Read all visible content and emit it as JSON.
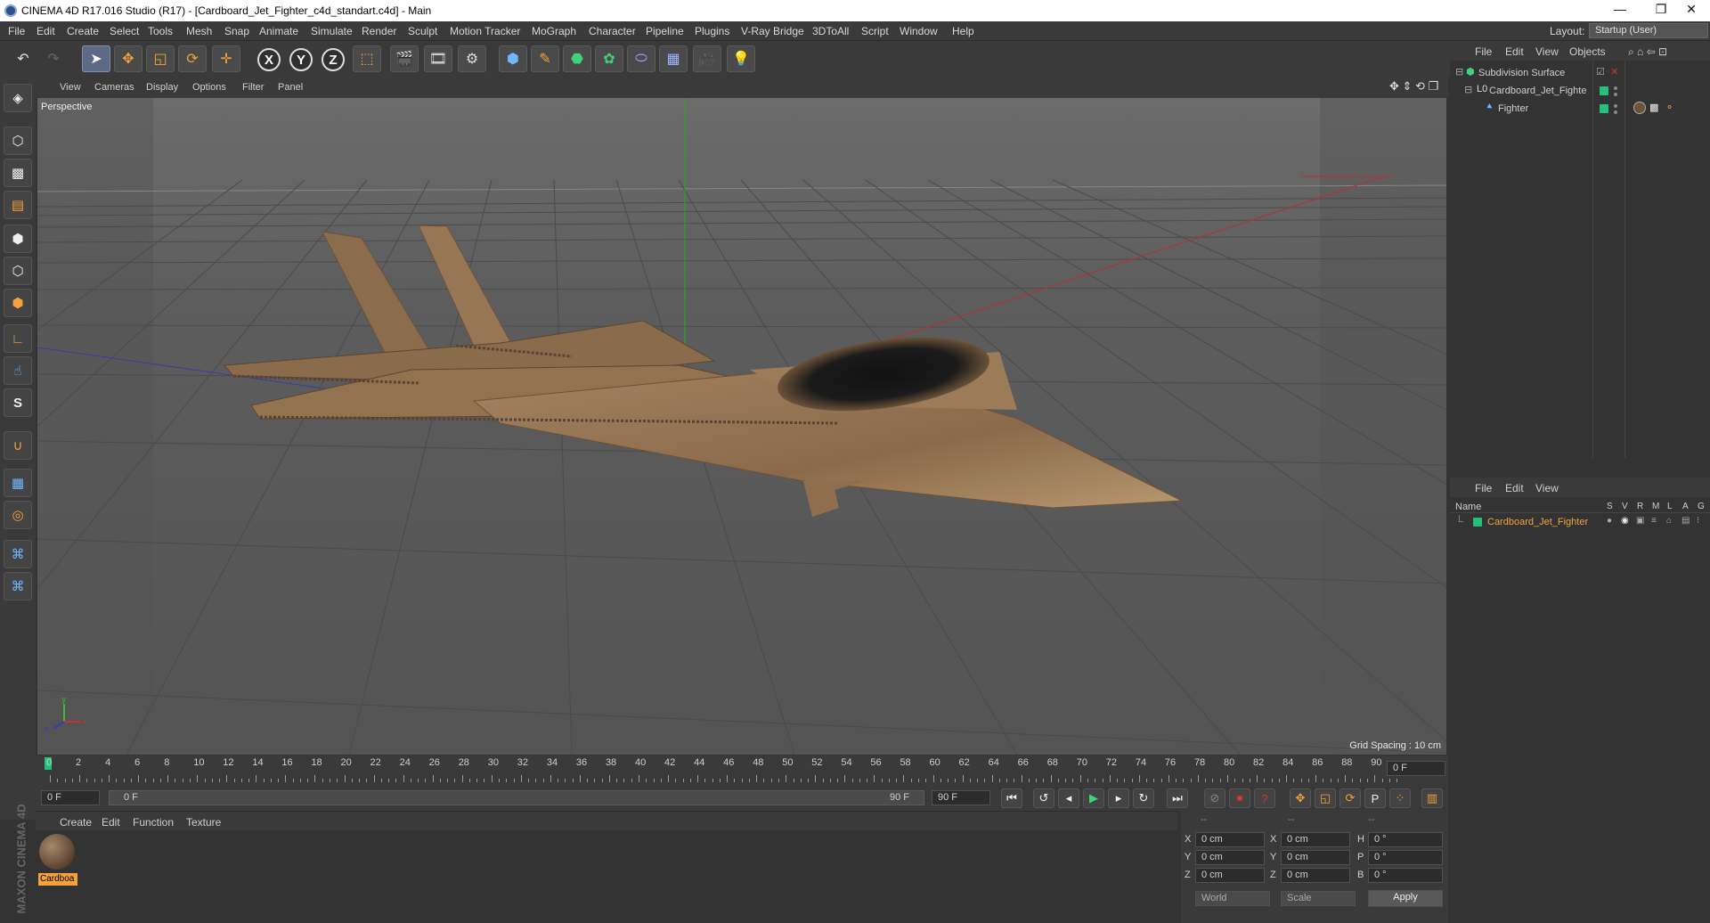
{
  "window": {
    "title": "CINEMA 4D R17.016 Studio (R17) - [Cardboard_Jet_Fighter_c4d_standart.c4d] - Main",
    "minimize": "—",
    "restore": "❐",
    "close": "✕"
  },
  "menu": [
    "File",
    "Edit",
    "Create",
    "Select",
    "Tools",
    "Mesh",
    "Snap",
    "Animate",
    "Simulate",
    "Render",
    "Sculpt",
    "Motion Tracker",
    "MoGraph",
    "Character",
    "Pipeline",
    "Plugins",
    "V-Ray Bridge",
    "3DToAll",
    "Script",
    "Window",
    "Help"
  ],
  "layout": {
    "label": "Layout:",
    "value": "Startup (User)"
  },
  "toolbar_axes": [
    "X",
    "Y",
    "Z"
  ],
  "viewport": {
    "menu": [
      "View",
      "Cameras",
      "Display",
      "Options",
      "Filter",
      "Panel"
    ],
    "camera": "Perspective",
    "grid_spacing": "Grid Spacing : 10 cm"
  },
  "timeline": {
    "ticks": [
      "0",
      "2",
      "4",
      "6",
      "8",
      "10",
      "12",
      "14",
      "16",
      "18",
      "20",
      "22",
      "24",
      "26",
      "28",
      "30",
      "32",
      "34",
      "36",
      "38",
      "40",
      "42",
      "44",
      "46",
      "48",
      "50",
      "52",
      "54",
      "56",
      "58",
      "60",
      "62",
      "64",
      "66",
      "68",
      "70",
      "72",
      "74",
      "76",
      "78",
      "80",
      "82",
      "84",
      "86",
      "88",
      "90"
    ],
    "current_frame": "0 F",
    "start_frame": "0 F",
    "range_start": "0 F",
    "range_end": "90 F",
    "end_frame": "90 F"
  },
  "material_menu": [
    "Create",
    "Edit",
    "Function",
    "Texture"
  ],
  "material": {
    "name": "Cardboa"
  },
  "coordinates": {
    "header": [
      "--",
      "--",
      "--"
    ],
    "rows": [
      {
        "a": "X",
        "av": "0 cm",
        "b": "X",
        "bv": "0 cm",
        "c": "H",
        "cv": "0 °"
      },
      {
        "a": "Y",
        "av": "0 cm",
        "b": "Y",
        "bv": "0 cm",
        "c": "P",
        "cv": "0 °"
      },
      {
        "a": "Z",
        "av": "0 cm",
        "b": "Z",
        "bv": "0 cm",
        "c": "B",
        "cv": "0 °"
      }
    ],
    "mode": "World",
    "transform": "Scale",
    "apply": "Apply"
  },
  "object_manager": {
    "menu": [
      "File",
      "Edit",
      "View",
      "Objects"
    ],
    "items": [
      {
        "name": "Subdivision Surface"
      },
      {
        "name": "Cardboard_Jet_Fighte"
      },
      {
        "name": "Fighter"
      }
    ]
  },
  "layer_manager": {
    "menu": [
      "File",
      "Edit",
      "View"
    ],
    "columns": {
      "name": "Name",
      "flags": [
        "S",
        "V",
        "R",
        "M",
        "L",
        "A",
        "G"
      ]
    },
    "layer": "Cardboard_Jet_Fighter"
  },
  "maxon": "MAXON CINEMA 4D",
  "colors": {
    "accent": "#f3a23a",
    "layer_green": "#25c07a",
    "viewport_bg": "#5f5f5f"
  }
}
